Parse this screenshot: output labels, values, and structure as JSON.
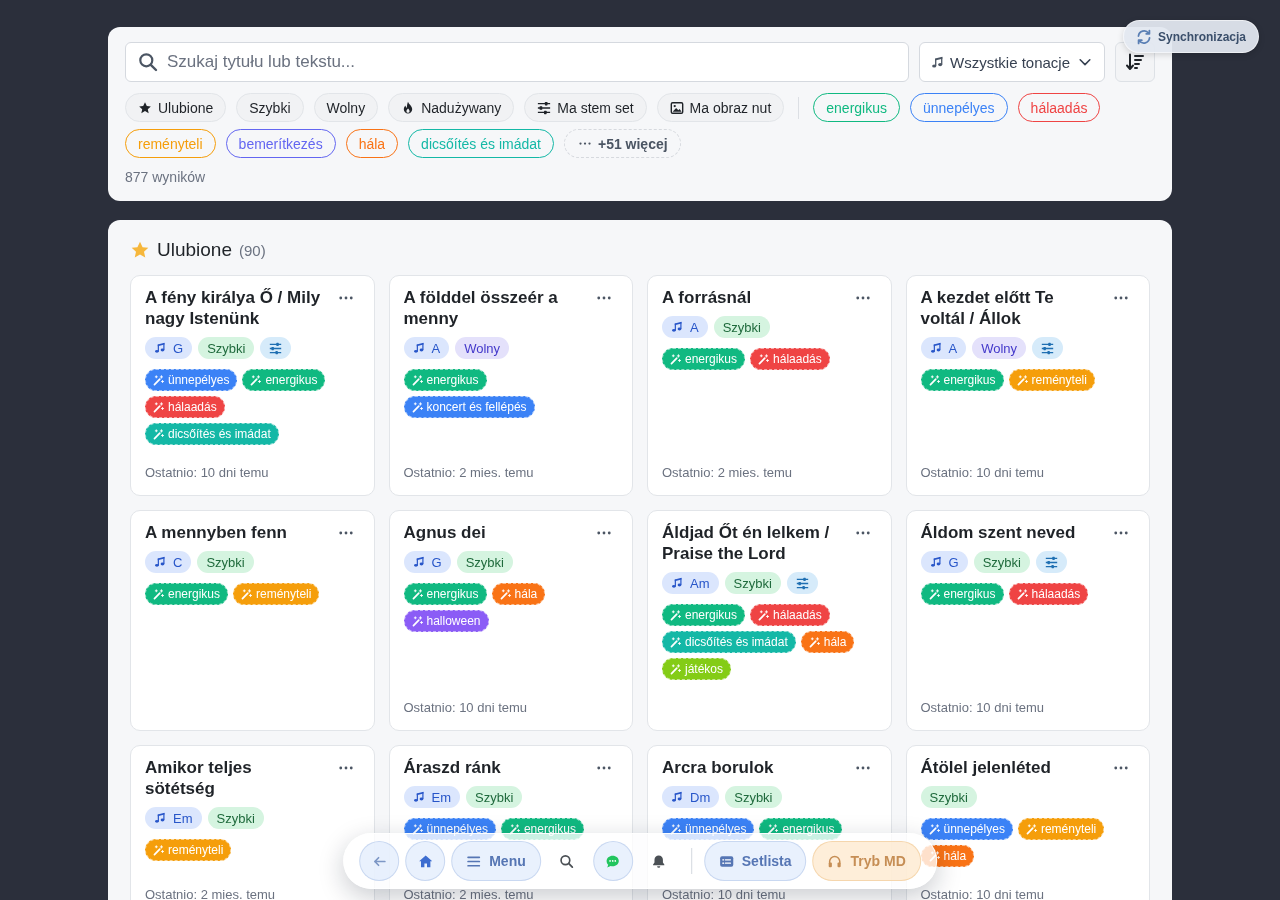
{
  "sync_status": {
    "label": "Synchronizacja"
  },
  "filters": {
    "search": {
      "placeholder": "Szukaj tytułu lub tekstu..."
    },
    "key_select": {
      "value": "Wszystkie tonacje"
    },
    "quick_filters": [
      {
        "label": "Ulubione",
        "kind": "favorite",
        "selected": false
      },
      {
        "label": "Szybki",
        "kind": "plain",
        "selected": false
      },
      {
        "label": "Wolny",
        "kind": "plain",
        "selected": false
      },
      {
        "label": "Nadużywany",
        "kind": "overused",
        "selected": false
      },
      {
        "label": "Ma stem set",
        "kind": "stems",
        "selected": false
      },
      {
        "label": "Ma obraz nut",
        "kind": "sheet",
        "selected": false
      }
    ],
    "mood_filters": [
      {
        "label": "energikus",
        "color": "#10b981",
        "selected": false
      },
      {
        "label": "ünnepélyes",
        "color": "#3b82f6",
        "selected": false
      },
      {
        "label": "hálaadás",
        "color": "#ef4444",
        "selected": false
      },
      {
        "label": "reményteli",
        "color": "#f59e0b",
        "selected": false
      },
      {
        "label": "bemerítkezés",
        "color": "#6366f1",
        "selected": false
      },
      {
        "label": "hála",
        "color": "#f97316",
        "selected": false
      },
      {
        "label": "dicsőítés és imádat",
        "color": "#14b8a6",
        "selected": false
      }
    ],
    "more_button": {
      "label": "+51 więcej"
    },
    "result_count": "877 wyników"
  },
  "section": {
    "title": "Ulubione",
    "count": "(90)"
  },
  "songs": [
    {
      "title": "A fény királya Ő / Mily nagy Istenünk",
      "key": "G",
      "tempo": {
        "label": "Szybki",
        "kind": "fast"
      },
      "stems": true,
      "tags": [
        {
          "label": "ünnepélyes",
          "color": "#3b82f6"
        },
        {
          "label": "energikus",
          "color": "#10b981"
        },
        {
          "label": "hálaadás",
          "color": "#ef4444"
        },
        {
          "label": "dicsőítés és imádat",
          "color": "#14b8a6"
        }
      ],
      "last_used": "Ostatnio: 10 dni temu"
    },
    {
      "title": "A földdel összeér a menny",
      "key": "A",
      "tempo": {
        "label": "Wolny",
        "kind": "slow"
      },
      "stems": false,
      "tags": [
        {
          "label": "energikus",
          "color": "#10b981"
        },
        {
          "label": "koncert és fellépés",
          "color": "#3b82f6"
        }
      ],
      "last_used": "Ostatnio: 2 mies. temu"
    },
    {
      "title": "A forrásnál",
      "key": "A",
      "tempo": {
        "label": "Szybki",
        "kind": "fast"
      },
      "stems": false,
      "tags": [
        {
          "label": "energikus",
          "color": "#10b981"
        },
        {
          "label": "hálaadás",
          "color": "#ef4444"
        }
      ],
      "last_used": "Ostatnio: 2 mies. temu"
    },
    {
      "title": "A kezdet előtt Te voltál / Állok",
      "key": "A",
      "tempo": {
        "label": "Wolny",
        "kind": "slow"
      },
      "stems": true,
      "tags": [
        {
          "label": "energikus",
          "color": "#10b981"
        },
        {
          "label": "reményteli",
          "color": "#f59e0b"
        }
      ],
      "last_used": "Ostatnio: 10 dni temu"
    },
    {
      "title": "A mennyben fenn",
      "key": "C",
      "tempo": {
        "label": "Szybki",
        "kind": "fast"
      },
      "stems": false,
      "tags": [
        {
          "label": "energikus",
          "color": "#10b981"
        },
        {
          "label": "reményteli",
          "color": "#f59e0b"
        }
      ]
    },
    {
      "title": "Agnus dei",
      "key": "G",
      "tempo": {
        "label": "Szybki",
        "kind": "fast"
      },
      "stems": false,
      "tags": [
        {
          "label": "energikus",
          "color": "#10b981"
        },
        {
          "label": "hála",
          "color": "#f97316"
        },
        {
          "label": "halloween",
          "color": "#8b5cf6"
        }
      ],
      "last_used": "Ostatnio: 10 dni temu"
    },
    {
      "title": "Áldjad Őt én lelkem / Praise the Lord",
      "key": "Am",
      "tempo": {
        "label": "Szybki",
        "kind": "fast"
      },
      "stems": true,
      "tags": [
        {
          "label": "energikus",
          "color": "#10b981"
        },
        {
          "label": "hálaadás",
          "color": "#ef4444"
        },
        {
          "label": "dicsőítés és imádat",
          "color": "#14b8a6"
        },
        {
          "label": "hála",
          "color": "#f97316"
        },
        {
          "label": "játékos",
          "color": "#84cc16"
        }
      ]
    },
    {
      "title": "Áldom szent neved",
      "key": "G",
      "tempo": {
        "label": "Szybki",
        "kind": "fast"
      },
      "stems": true,
      "tags": [
        {
          "label": "energikus",
          "color": "#10b981"
        },
        {
          "label": "hálaadás",
          "color": "#ef4444"
        }
      ],
      "last_used": "Ostatnio: 10 dni temu"
    },
    {
      "title": "Amikor teljes sötétség",
      "key": "Em",
      "tempo": {
        "label": "Szybki",
        "kind": "fast"
      },
      "stems": false,
      "tags": [
        {
          "label": "reményteli",
          "color": "#f59e0b"
        }
      ],
      "last_used": "Ostatnio: 2 mies. temu"
    },
    {
      "title": "Áraszd ránk",
      "key": "Em",
      "tempo": {
        "label": "Szybki",
        "kind": "fast"
      },
      "stems": false,
      "tags": [
        {
          "label": "ünnepélyes",
          "color": "#3b82f6"
        },
        {
          "label": "energikus",
          "color": "#10b981"
        }
      ],
      "last_used": "Ostatnio: 2 mies. temu"
    },
    {
      "title": "Arcra borulok",
      "key": "Dm",
      "tempo": {
        "label": "Szybki",
        "kind": "fast"
      },
      "stems": false,
      "tags": [
        {
          "label": "ünnepélyes",
          "color": "#3b82f6"
        },
        {
          "label": "energikus",
          "color": "#10b981"
        }
      ],
      "last_used": "Ostatnio: 10 dni temu"
    },
    {
      "title": "Átölel jelenléted",
      "tempo": {
        "label": "Szybki",
        "kind": "fast"
      },
      "stems": false,
      "tags": [
        {
          "label": "ünnepélyes",
          "color": "#3b82f6"
        },
        {
          "label": "reményteli",
          "color": "#f59e0b"
        },
        {
          "label": "hála",
          "color": "#f97316"
        }
      ],
      "last_used": "Ostatnio: 10 dni temu"
    }
  ],
  "bottom_nav": [
    {
      "kind": "back"
    },
    {
      "kind": "home"
    },
    {
      "kind": "menu",
      "label": "Menu"
    },
    {
      "kind": "search"
    },
    {
      "kind": "chat"
    },
    {
      "kind": "notifications"
    },
    {
      "kind": "divider"
    },
    {
      "kind": "setlist",
      "label": "Setlista"
    },
    {
      "kind": "mode",
      "label": "Tryb MD"
    }
  ]
}
